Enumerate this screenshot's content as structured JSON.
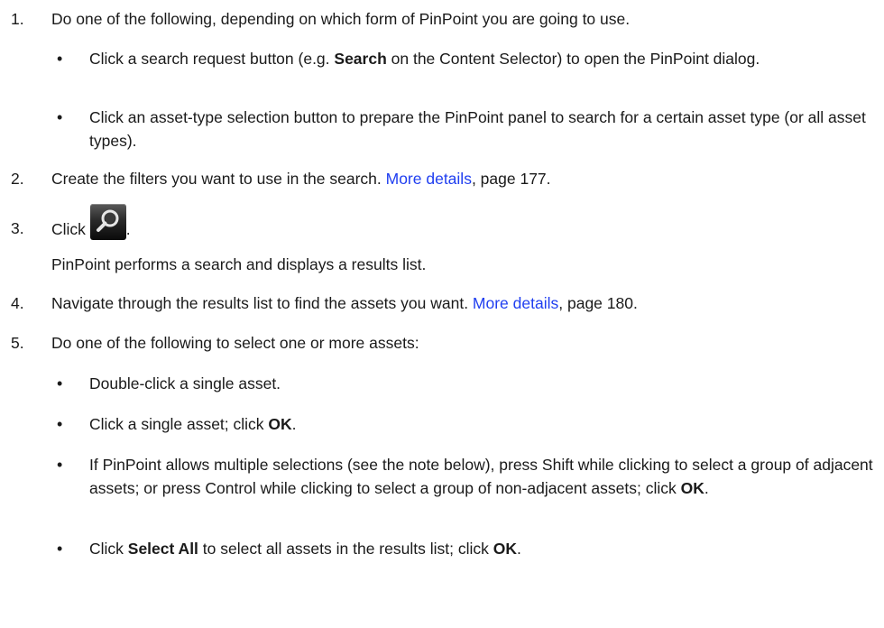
{
  "steps": [
    {
      "num": "1.",
      "text": "Do one of the following, depending on which form of PinPoint you are going to use."
    },
    {
      "num": "2.",
      "text_pre": "Create the filters you want to use in the search. ",
      "link": "More details",
      "text_post": ", page 177."
    },
    {
      "num": "3.",
      "text_pre": "Click ",
      "text_post": ".",
      "result": "PinPoint performs a search and displays a results list."
    },
    {
      "num": "4.",
      "text_pre": "Navigate through the results list to find the assets you want. ",
      "link": "More details",
      "text_post": ", page 180."
    },
    {
      "num": "5.",
      "text": "Do one of the following to select one or more assets:"
    }
  ],
  "step1_bullets": [
    {
      "pre": "Click a search request button (e.g. ",
      "bold": "Search",
      "post": " on the Content Selector) to open the PinPoint dialog."
    },
    {
      "text": "Click an asset-type selection button to prepare the PinPoint panel to search for a certain asset type (or all asset types)."
    }
  ],
  "step5_bullets": [
    {
      "text": "Double-click a single asset."
    },
    {
      "pre": "Click a single asset; click ",
      "bold": "OK",
      "post": "."
    },
    {
      "pre": "If PinPoint allows multiple selections (see the note below), press Shift while clicking to select a group of adjacent assets; or press Control while clicking to select a group of non-adjacent assets; click ",
      "bold": "OK",
      "post": "."
    },
    {
      "pre": "Click ",
      "bold": "Select All",
      "post": " to select all assets in the results list; click ",
      "bold2": "OK",
      "post2": "."
    }
  ],
  "bullet_glyph": "•",
  "icons": {
    "search_button": "magnifier-icon"
  },
  "colors": {
    "link": "#1f3ef0",
    "text": "#1a1a1a"
  }
}
